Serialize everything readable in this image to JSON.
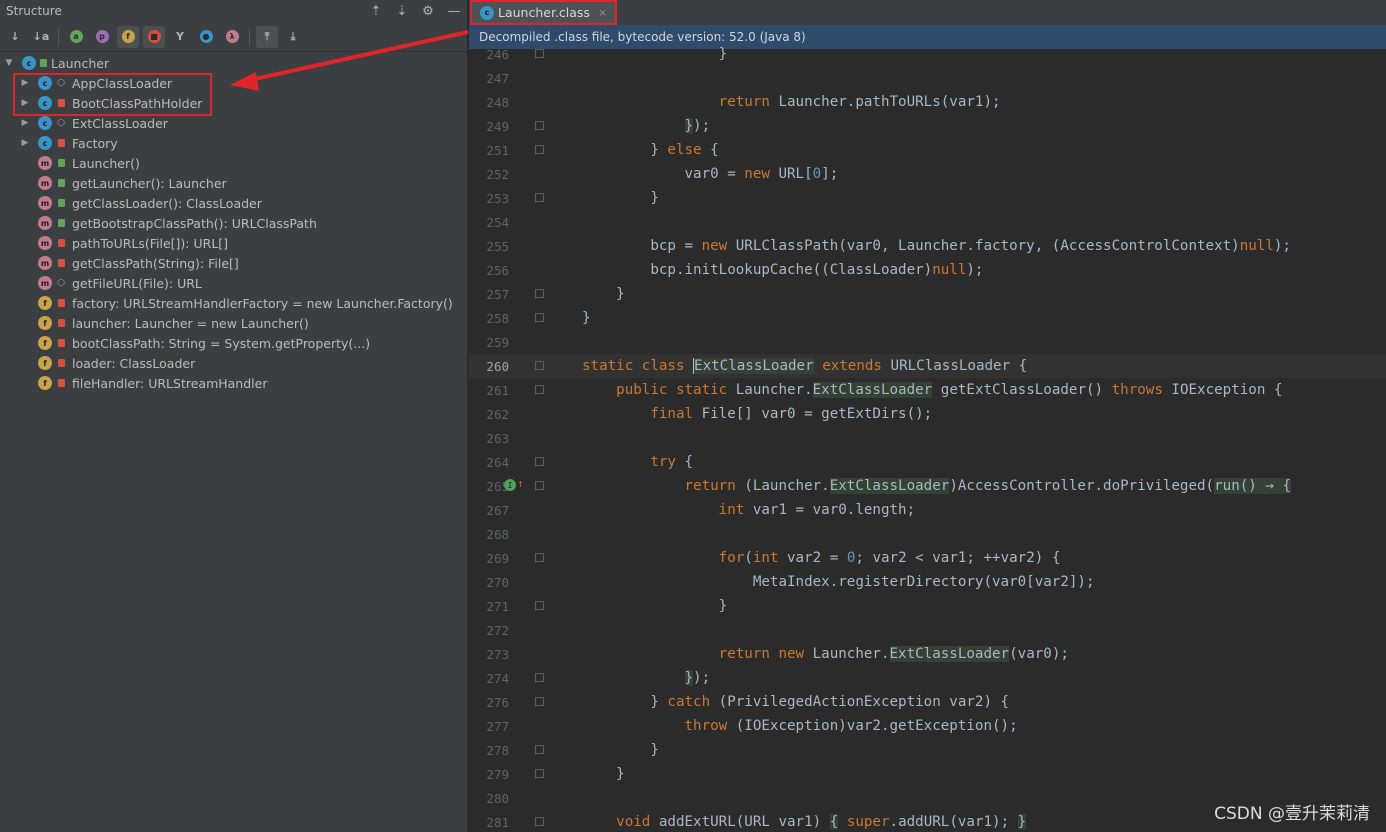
{
  "structure_panel": {
    "title": "Structure",
    "header_icons": [
      "expand-all-icon",
      "collapse-all-icon",
      "settings-icon",
      "hide-icon"
    ],
    "toolbar": [
      {
        "icon": "sort-by-visibility-icon",
        "glyph": "↓",
        "on": false
      },
      {
        "icon": "sort-alpha-icon",
        "glyph": "↓a",
        "on": false
      },
      {
        "icon": "show-inherited-icon",
        "glyph": "a",
        "color": "#62a35a",
        "on": false
      },
      {
        "icon": "show-properties-icon",
        "glyph": "p",
        "color": "#9b6fb0",
        "on": false
      },
      {
        "icon": "show-fields-icon",
        "glyph": "f",
        "color": "#c9a24c",
        "on": true
      },
      {
        "icon": "show-non-public-icon",
        "glyph": "■",
        "color": "#d9503f",
        "on": true
      },
      {
        "icon": "show-hierarchy-icon",
        "glyph": "Y",
        "on": false
      },
      {
        "icon": "show-anonymous-icon",
        "glyph": "●",
        "color": "#3b92c4",
        "on": false
      },
      {
        "icon": "show-lambdas-icon",
        "glyph": "λ",
        "color": "#c07c8e",
        "on": false
      },
      {
        "icon": "autoscroll-to-source-icon",
        "glyph": "⤒",
        "on": true
      },
      {
        "icon": "autoscroll-from-source-icon",
        "glyph": "⤓",
        "on": false
      }
    ],
    "root": {
      "label": "Launcher",
      "kind": "c"
    },
    "items": [
      {
        "label": "AppClassLoader",
        "kind": "c",
        "vis": "pkg",
        "expandable": true
      },
      {
        "label": "BootClassPathHolder",
        "kind": "c",
        "vis": "lock",
        "expandable": true
      },
      {
        "label": "ExtClassLoader",
        "kind": "c",
        "vis": "pkg",
        "expandable": true
      },
      {
        "label": "Factory",
        "kind": "c",
        "vis": "lock",
        "expandable": true
      },
      {
        "label": "Launcher()",
        "kind": "m",
        "vis": "open",
        "expandable": false
      },
      {
        "label": "getLauncher(): Launcher",
        "kind": "m",
        "vis": "open",
        "expandable": false
      },
      {
        "label": "getClassLoader(): ClassLoader",
        "kind": "m",
        "vis": "open",
        "expandable": false
      },
      {
        "label": "getBootstrapClassPath(): URLClassPath",
        "kind": "m",
        "vis": "open",
        "expandable": false
      },
      {
        "label": "pathToURLs(File[]): URL[]",
        "kind": "m",
        "vis": "lock",
        "expandable": false
      },
      {
        "label": "getClassPath(String): File[]",
        "kind": "m",
        "vis": "lock",
        "expandable": false
      },
      {
        "label": "getFileURL(File): URL",
        "kind": "m",
        "vis": "pkg",
        "expandable": false
      },
      {
        "label": "factory: URLStreamHandlerFactory = new Launcher.Factory()",
        "kind": "f",
        "vis": "lock",
        "expandable": false
      },
      {
        "label": "launcher: Launcher = new Launcher()",
        "kind": "f",
        "vis": "lock",
        "expandable": false
      },
      {
        "label": "bootClassPath: String = System.getProperty(...)",
        "kind": "f",
        "vis": "lock",
        "expandable": false
      },
      {
        "label": "loader: ClassLoader",
        "kind": "f",
        "vis": "lock",
        "expandable": false
      },
      {
        "label": "fileHandler: URLStreamHandler",
        "kind": "f",
        "vis": "lock",
        "expandable": false
      }
    ]
  },
  "editor": {
    "tab": {
      "label": "Launcher.class",
      "close": "×"
    },
    "banner": "Decompiled .class file, bytecode version: 52.0 (Java 8)",
    "lines": [
      {
        "n": "246",
        "html": "                }",
        "fold": true
      },
      {
        "n": "247",
        "html": "",
        "fold": false
      },
      {
        "n": "248",
        "html": "                <span class=\"kw\">return</span> Launcher.pathToURLs(var1);",
        "fold": false
      },
      {
        "n": "249",
        "html": "            <span class=\"hl\">}</span>);",
        "fold": true
      },
      {
        "n": "251",
        "html": "        } <span class=\"kw\">else</span> {",
        "fold": true
      },
      {
        "n": "252",
        "html": "            var0 = <span class=\"kw\">new</span> URL[<span class=\"num-l\">0</span>];",
        "fold": false
      },
      {
        "n": "253",
        "html": "        }",
        "fold": true
      },
      {
        "n": "254",
        "html": "",
        "fold": false
      },
      {
        "n": "255",
        "html": "        bcp = <span class=\"kw\">new</span> URLClassPath(var0, Launcher.factory, (AccessControlContext)<span class=\"kw\">null</span>);",
        "fold": false
      },
      {
        "n": "256",
        "html": "        bcp.initLookupCache((ClassLoader)<span class=\"kw\">null</span>);",
        "fold": false
      },
      {
        "n": "257",
        "html": "    }",
        "fold": true
      },
      {
        "n": "258",
        "html": "}",
        "fold": true
      },
      {
        "n": "259",
        "html": "",
        "fold": false
      },
      {
        "n": "260",
        "html": "<span class=\"kw\">static class</span> <span class=\"cursor\"></span><span class=\"hl\">ExtClassLoader</span> <span class=\"kw\">extends</span> URLClassLoader {",
        "fold": true,
        "current": true
      },
      {
        "n": "261",
        "html": "    <span class=\"kw\">public static</span> Launcher.<span class=\"hl\">ExtClassLoader</span> getExtClassLoader() <span class=\"kw\">throws</span> IOException {",
        "fold": true
      },
      {
        "n": "262",
        "html": "        <span class=\"kw\">final</span> File[] var0 = getExtDirs();",
        "fold": false
      },
      {
        "n": "263",
        "html": "",
        "fold": false
      },
      {
        "n": "264",
        "html": "        <span class=\"kw\">try</span> {",
        "fold": true
      },
      {
        "n": "265",
        "html": "            <span class=\"kw\">return</span> (Launcher.<span class=\"hl\">ExtClassLoader</span>)AccessController.doPrivileged(<span class=\"hl\">run() → {</span>",
        "fold": true,
        "marker": true
      },
      {
        "n": "267",
        "html": "                <span class=\"kw\">int</span> var1 = var0.length;",
        "fold": false
      },
      {
        "n": "268",
        "html": "",
        "fold": false
      },
      {
        "n": "269",
        "html": "                <span class=\"kw\">for</span>(<span class=\"kw\">int</span> var2 = <span class=\"num-l\">0</span>; var2 &lt; var1; ++var2) {",
        "fold": true
      },
      {
        "n": "270",
        "html": "                    MetaIndex.registerDirectory(var0[var2]);",
        "fold": false
      },
      {
        "n": "271",
        "html": "                }",
        "fold": true
      },
      {
        "n": "272",
        "html": "",
        "fold": false
      },
      {
        "n": "273",
        "html": "                <span class=\"kw\">return new</span> Launcher.<span class=\"hl\">ExtClassLoader</span>(var0);",
        "fold": false
      },
      {
        "n": "274",
        "html": "            <span class=\"hl\">}</span>);",
        "fold": true
      },
      {
        "n": "276",
        "html": "        } <span class=\"kw\">catch</span> (PrivilegedActionException var2) {",
        "fold": true
      },
      {
        "n": "277",
        "html": "            <span class=\"kw\">throw</span> (IOException)var2.getException();",
        "fold": false
      },
      {
        "n": "278",
        "html": "        }",
        "fold": true
      },
      {
        "n": "279",
        "html": "    }",
        "fold": true
      },
      {
        "n": "280",
        "html": "",
        "fold": false
      },
      {
        "n": "281",
        "html": "    <span class=\"kw\">void</span> addExtURL(URL var1) <span class=\"hl\">{</span> <span class=\"kw\">super</span>.addURL(var1); <span class=\"hl\">}</span>",
        "fold": true
      }
    ]
  },
  "watermark": "CSDN @壹升茉莉清",
  "colors": {
    "annotation_red": "#e0242b",
    "keyword": "#cc7832",
    "number": "#6897bb",
    "banner_bg": "#2f4a6b"
  }
}
